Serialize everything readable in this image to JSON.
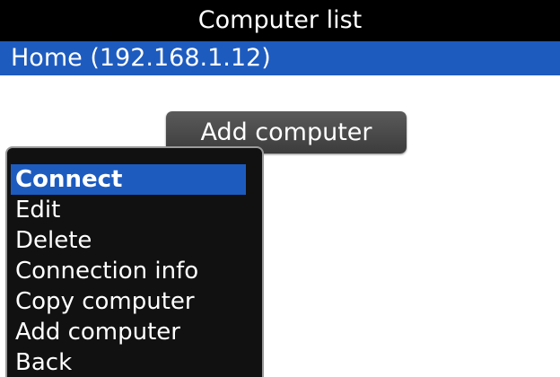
{
  "header": {
    "title": "Computer list"
  },
  "computers": [
    {
      "label": "Home (192.168.1.12)",
      "selected": true
    }
  ],
  "add_button_label": "Add computer",
  "menu": {
    "items": [
      {
        "label": "Connect",
        "selected": true
      },
      {
        "label": "Edit"
      },
      {
        "label": "Delete"
      },
      {
        "label": "Connection info"
      },
      {
        "label": "Copy computer"
      },
      {
        "label": "Add computer"
      },
      {
        "label": "Back"
      }
    ]
  },
  "colors": {
    "title_bar": "#000000",
    "selection": "#1d5bbf",
    "menu_background": "#111111",
    "button": "#4a4a4a"
  }
}
